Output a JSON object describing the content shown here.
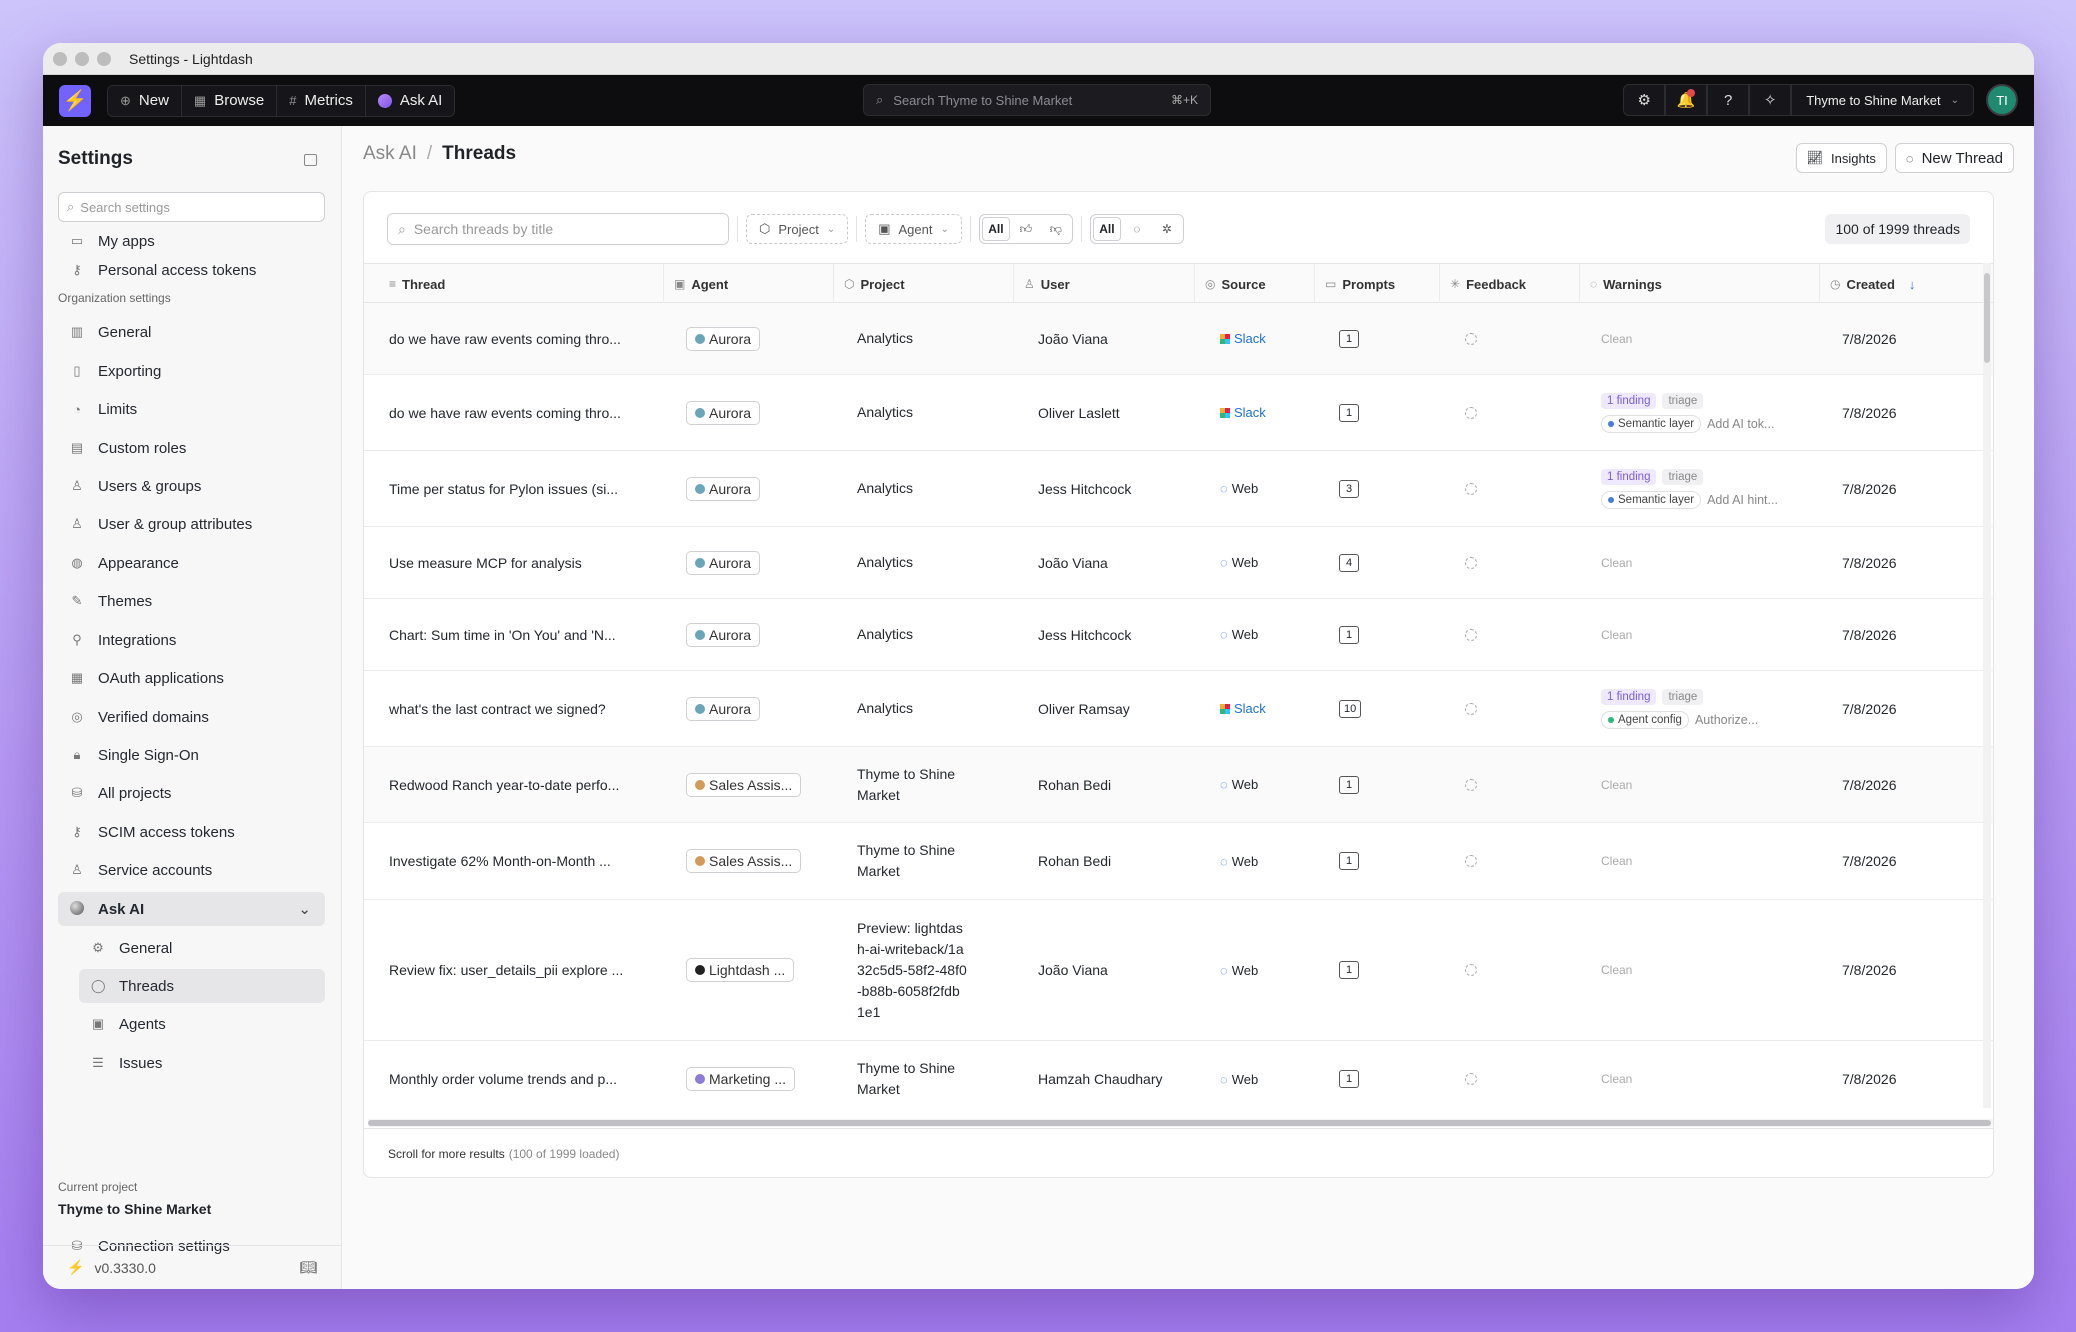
{
  "window": {
    "title": "Settings - Lightdash"
  },
  "topnav": {
    "new_label": "New",
    "browse_label": "Browse",
    "metrics_label": "Metrics",
    "askai_label": "Ask AI",
    "search_placeholder": "Search Thyme to Shine Market",
    "search_shortcut": "⌘+K",
    "project_label": "Thyme to Shine Market",
    "avatar_initials": "TI"
  },
  "sidebar": {
    "title": "Settings",
    "search_placeholder": "Search settings",
    "personal_items": [
      {
        "label": "My apps",
        "icon": "window-icon"
      },
      {
        "label": "Personal access tokens",
        "icon": "key-icon"
      }
    ],
    "org_section_label": "Organization settings",
    "org_items": [
      {
        "label": "General",
        "icon": "building-icon"
      },
      {
        "label": "Exporting",
        "icon": "file-export-icon"
      },
      {
        "label": "Limits",
        "icon": "gauge-icon"
      },
      {
        "label": "Custom roles",
        "icon": "id-badge-icon"
      },
      {
        "label": "Users & groups",
        "icon": "user-plus-icon"
      },
      {
        "label": "User & group attributes",
        "icon": "user-cog-icon"
      },
      {
        "label": "Appearance",
        "icon": "palette-icon"
      },
      {
        "label": "Themes",
        "icon": "brush-icon"
      },
      {
        "label": "Integrations",
        "icon": "plug-icon"
      },
      {
        "label": "OAuth applications",
        "icon": "apps-icon"
      },
      {
        "label": "Verified domains",
        "icon": "globe-icon"
      },
      {
        "label": "Single Sign-On",
        "icon": "lock-icon"
      },
      {
        "label": "All projects",
        "icon": "database-icon"
      },
      {
        "label": "SCIM access tokens",
        "icon": "key-icon"
      },
      {
        "label": "Service accounts",
        "icon": "user-icon"
      }
    ],
    "ask_ai_label": "Ask AI",
    "ask_ai_items": [
      {
        "label": "General",
        "icon": "gear-icon"
      },
      {
        "label": "Threads",
        "icon": "message-icon"
      },
      {
        "label": "Agents",
        "icon": "agent-icon"
      },
      {
        "label": "Issues",
        "icon": "list-icon"
      }
    ],
    "current_project_label": "Current project",
    "current_project_name": "Thyme to Shine Market",
    "connection_settings_label": "Connection settings",
    "version": "v0.3330.0"
  },
  "header": {
    "breadcrumb_parent": "Ask AI",
    "breadcrumb_separator": "/",
    "breadcrumb_current": "Threads",
    "insights_label": "Insights",
    "new_thread_label": "New Thread"
  },
  "filters": {
    "search_placeholder": "Search threads by title",
    "project_label": "Project",
    "agent_label": "Agent",
    "feedback_all": "All",
    "source_all": "All",
    "count_text": "100 of 1999 threads"
  },
  "table": {
    "columns": [
      "Thread",
      "Agent",
      "Project",
      "User",
      "Source",
      "Prompts",
      "Feedback",
      "Warnings",
      "Created"
    ],
    "rows": [
      {
        "thread": "do we have raw events coming thro...",
        "agent": "Aurora",
        "project": "Analytics",
        "user": "João Viana",
        "source": "Slack",
        "prompts": "1",
        "clean": "Clean",
        "created": "7/8/2026"
      },
      {
        "thread": "do we have raw events coming thro...",
        "agent": "Aurora",
        "project": "Analytics",
        "user": "Oliver Laslett",
        "source": "Slack",
        "prompts": "1",
        "finding": "1 finding",
        "tag": "triage",
        "layer": "Semantic layer",
        "hint": "Add AI tok...",
        "created": "7/8/2026"
      },
      {
        "thread": "Time per status for Pylon issues (si...",
        "agent": "Aurora",
        "project": "Analytics",
        "user": "Jess Hitchcock",
        "source": "Web",
        "prompts": "3",
        "finding": "1 finding",
        "tag": "triage",
        "layer": "Semantic layer",
        "hint": "Add AI hint...",
        "created": "7/8/2026"
      },
      {
        "thread": "Use measure MCP for analysis",
        "agent": "Aurora",
        "project": "Analytics",
        "user": "João Viana",
        "source": "Web",
        "prompts": "4",
        "clean": "Clean",
        "created": "7/8/2026"
      },
      {
        "thread": "Chart: Sum time in 'On You' and 'N...",
        "agent": "Aurora",
        "project": "Analytics",
        "user": "Jess Hitchcock",
        "source": "Web",
        "prompts": "1",
        "clean": "Clean",
        "created": "7/8/2026"
      },
      {
        "thread": "what's the last contract we signed?",
        "agent": "Aurora",
        "project": "Analytics",
        "user": "Oliver Ramsay",
        "source": "Slack",
        "prompts": "10",
        "finding": "1 finding",
        "tag": "triage",
        "layer": "Agent config",
        "hint": "Authorize...",
        "created": "7/8/2026"
      },
      {
        "thread": "Redwood Ranch year-to-date perfo...",
        "agent": "Sales Assis...",
        "project": "Thyme to Shine Market",
        "user": "Rohan Bedi",
        "source": "Web",
        "prompts": "1",
        "clean": "Clean",
        "created": "7/8/2026"
      },
      {
        "thread": "Investigate 62% Month-on-Month ...",
        "agent": "Sales Assis...",
        "project": "Thyme to Shine Market",
        "user": "Rohan Bedi",
        "source": "Web",
        "prompts": "1",
        "clean": "Clean",
        "created": "7/8/2026"
      },
      {
        "thread": "Review fix: user_details_pii explore ...",
        "agent": "Lightdash ...",
        "project": "Preview: lightdash-ai-writeback/1a32c5d5-58f2-48f0-b88b-6058f2fdb1e1",
        "user": "João Viana",
        "source": "Web",
        "prompts": "1",
        "clean": "Clean",
        "created": "7/8/2026"
      },
      {
        "thread": "Monthly order volume trends and p...",
        "agent": "Marketing ...",
        "project": "Thyme to Shine Market",
        "user": "Hamzah Chaudhary",
        "source": "Web",
        "prompts": "1",
        "clean": "Clean",
        "created": "7/8/2026"
      }
    ]
  },
  "footer": {
    "scroll_text": "Scroll for more results",
    "loaded_text": "(100 of 1999 loaded)"
  }
}
